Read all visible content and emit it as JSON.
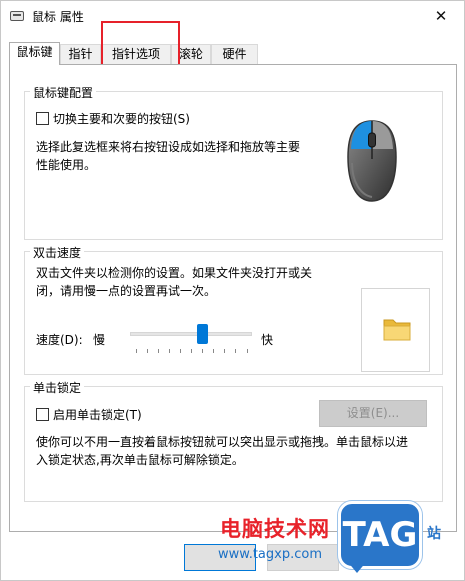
{
  "window": {
    "title": "鼠标 属性",
    "close_glyph": "✕"
  },
  "tabs": [
    {
      "label": "鼠标键"
    },
    {
      "label": "指针"
    },
    {
      "label": "指针选项"
    },
    {
      "label": "滚轮"
    },
    {
      "label": "硬件"
    }
  ],
  "active_tab": "鼠标键",
  "button_config": {
    "group_title": "鼠标键配置",
    "checkbox_label": "切换主要和次要的按钮(S)",
    "checkbox_checked": false,
    "description_line1": "选择此复选框来将右按钮设成如选择和拖放等主要",
    "description_line2": "性能使用。",
    "icon": "mouse-icon"
  },
  "double_click": {
    "group_title": "双击速度",
    "description_line1": "双击文件夹以检测你的设置。如果文件夹没打开或关",
    "description_line2": "闭，请用慢一点的设置再试一次。",
    "speed_label": "速度(D):",
    "slow_label": "慢",
    "fast_label": "快",
    "speed_value_fraction": 0.6,
    "test_icon": "folder-icon"
  },
  "click_lock": {
    "group_title": "单击锁定",
    "checkbox_label": "启用单击锁定(T)",
    "checkbox_checked": false,
    "settings_button": "设置(E)...",
    "description_line1": "使你可以不用一直按着鼠标按钮就可以突出显示或拖拽。单击鼠标以进",
    "description_line2": "入锁定状态,再次单击鼠标可解除锁定。"
  },
  "watermark": {
    "site_name": "电脑技术网",
    "url": "www.tagxp.com",
    "badge": "TAG",
    "side_text": "站"
  },
  "colors": {
    "accent": "#0078d7",
    "highlight": "#e6212a"
  }
}
